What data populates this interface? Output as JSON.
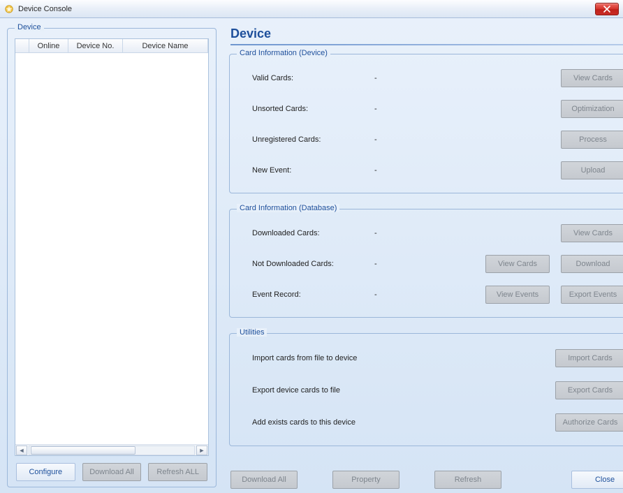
{
  "window": {
    "title": "Device Console"
  },
  "left": {
    "legend": "Device",
    "columns": {
      "online": "Online",
      "deviceNo": "Device No.",
      "deviceName": "Device Name"
    },
    "buttons": {
      "configure": "Configure",
      "downloadAll": "Download All",
      "refreshAll": "Refresh ALL"
    }
  },
  "right": {
    "title": "Device",
    "cardInfoDevice": {
      "legend": "Card Information (Device)",
      "rows": {
        "validCards": {
          "label": "Valid Cards:",
          "value": "-",
          "btn": "View Cards"
        },
        "unsorted": {
          "label": "Unsorted Cards:",
          "value": "-",
          "btn": "Optimization"
        },
        "unregistered": {
          "label": "Unregistered Cards:",
          "value": "-",
          "btn": "Process"
        },
        "newEvent": {
          "label": "New Event:",
          "value": "-",
          "btn": "Upload"
        }
      }
    },
    "cardInfoDb": {
      "legend": "Card Information (Database)",
      "rows": {
        "downloaded": {
          "label": "Downloaded Cards:",
          "value": "-",
          "btn1": "View Cards"
        },
        "notDownloaded": {
          "label": "Not Downloaded Cards:",
          "value": "-",
          "btn1": "View Cards",
          "btn2": "Download"
        },
        "eventRecord": {
          "label": "Event Record:",
          "value": "-",
          "btn1": "View Events",
          "btn2": "Export Events"
        }
      }
    },
    "utilities": {
      "legend": "Utilities",
      "rows": {
        "import": {
          "label": "Import cards from file to device",
          "btn": "Import Cards"
        },
        "export": {
          "label": "Export device cards to file",
          "btn": "Export Cards"
        },
        "authorize": {
          "label": "Add exists cards to this device",
          "btn": "Authorize Cards"
        }
      }
    },
    "bottom": {
      "downloadAll": "Download All",
      "property": "Property",
      "refresh": "Refresh",
      "close": "Close"
    }
  }
}
